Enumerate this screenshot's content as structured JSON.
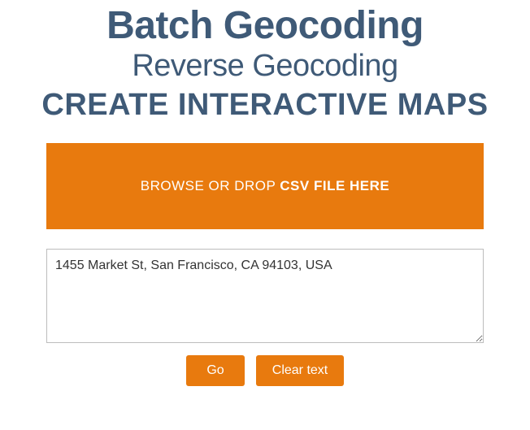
{
  "headings": {
    "main": "Batch Geocoding",
    "sub": "Reverse Geocoding",
    "maps": "CREATE INTERACTIVE MAPS"
  },
  "dropzone": {
    "prefix": "BROWSE OR DROP ",
    "bold": "CSV FILE HERE"
  },
  "input": {
    "value": "1455 Market St, San Francisco, CA 94103, USA"
  },
  "buttons": {
    "go": "Go",
    "clear": "Clear text"
  }
}
